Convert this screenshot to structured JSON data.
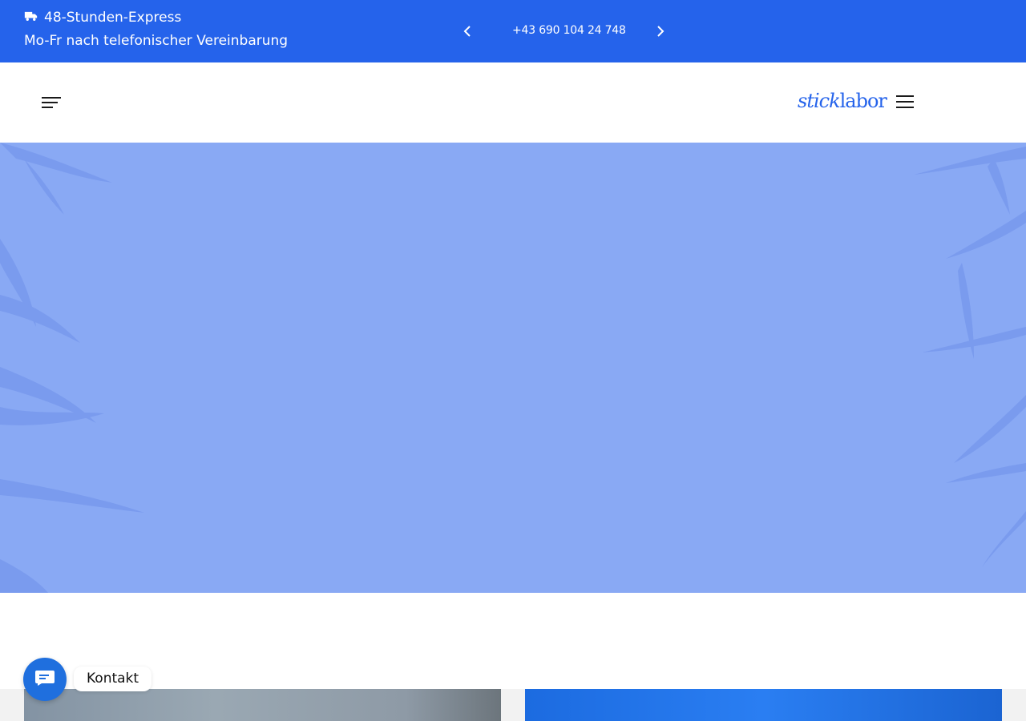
{
  "topbar": {
    "express_text": "48-Stunden-Express",
    "hours_text": "Mo-Fr nach telefonischer Vereinbarung",
    "phone": "+43 690 104 24 748",
    "icons": {
      "truck": "truck-icon",
      "prev": "chevron-left-icon",
      "next": "chevron-right-icon"
    }
  },
  "header": {
    "logo_part1": "stick",
    "logo_part2": "labor",
    "icons": {
      "left_menu": "menu-icon",
      "right_menu": "hamburger-icon"
    }
  },
  "contact": {
    "label": "Kontakt",
    "icon": "chat-icon"
  },
  "colors": {
    "brand_blue": "#2563eb",
    "hero_blue": "#89a9f4",
    "contact_blue": "#1f6fde"
  }
}
